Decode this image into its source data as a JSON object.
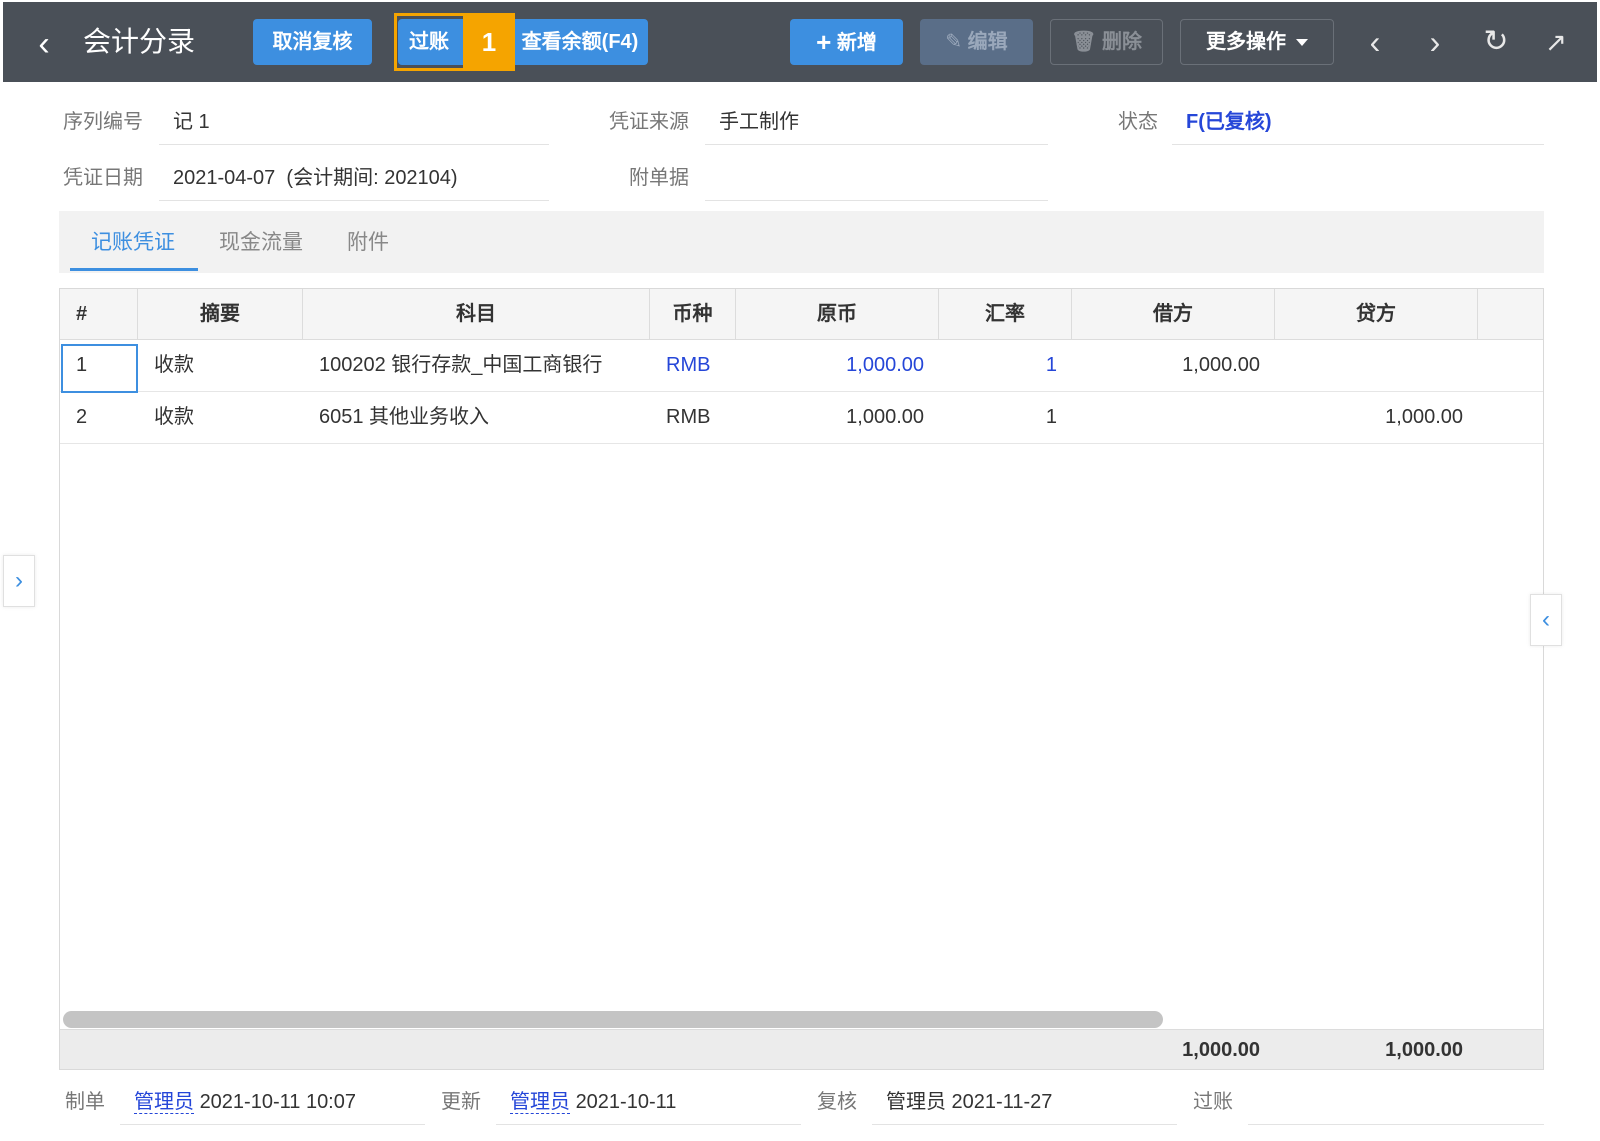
{
  "colors": {
    "accent": "#3d8fe0",
    "topbar": "#4a5058",
    "highlight": "#f5a400",
    "status": "#2546d8"
  },
  "header": {
    "title": "会计分录",
    "buttons": {
      "unreview": "取消复核",
      "post": "过账",
      "balance": "查看余额(F4)",
      "add": "新增",
      "edit": "编辑",
      "delete": "删除",
      "more": "更多操作"
    },
    "step_badge": "1",
    "icons": {
      "back": "chevron-left-icon",
      "prev": "chevron-left-icon",
      "next": "chevron-right-icon",
      "refresh": "refresh-icon",
      "export": "export-icon",
      "add": "plus-icon",
      "edit": "edit-icon",
      "delete": "trash-icon",
      "more": "caret-down-icon"
    }
  },
  "form": {
    "seq_label": "序列编号",
    "seq_value": "记 1",
    "source_label": "凭证来源",
    "source_value": "手工制作",
    "status_label": "状态",
    "status_value": "F(已复核)",
    "date_label": "凭证日期",
    "date_value": "2021-04-07  (会计期间: 202104)",
    "attach_label": "附单据",
    "attach_value": ""
  },
  "tabs": [
    "记账凭证",
    "现金流量",
    "附件"
  ],
  "table": {
    "headers": [
      "#",
      "摘要",
      "科目",
      "币种",
      "原币",
      "汇率",
      "借方",
      "贷方"
    ],
    "rows": [
      {
        "no": "1",
        "summary": "收款",
        "account": "100202 银行存款_中国工商银行",
        "currency": "RMB",
        "original": "1,000.00",
        "rate": "1",
        "debit": "1,000.00",
        "credit": ""
      },
      {
        "no": "2",
        "summary": "收款",
        "account": "6051 其他业务收入",
        "currency": "RMB",
        "original": "1,000.00",
        "rate": "1",
        "debit": "",
        "credit": "1,000.00"
      }
    ],
    "totals": {
      "debit": "1,000.00",
      "credit": "1,000.00"
    }
  },
  "footer": {
    "maker_label": "制单",
    "maker_user": "管理员",
    "maker_time": "2021-10-11 10:07",
    "update_label": "更新",
    "update_user": "管理员",
    "update_time": "2021-10-11",
    "review_label": "复核",
    "review_value": "管理员 2021-11-27",
    "post_label": "过账",
    "post_value": ""
  }
}
